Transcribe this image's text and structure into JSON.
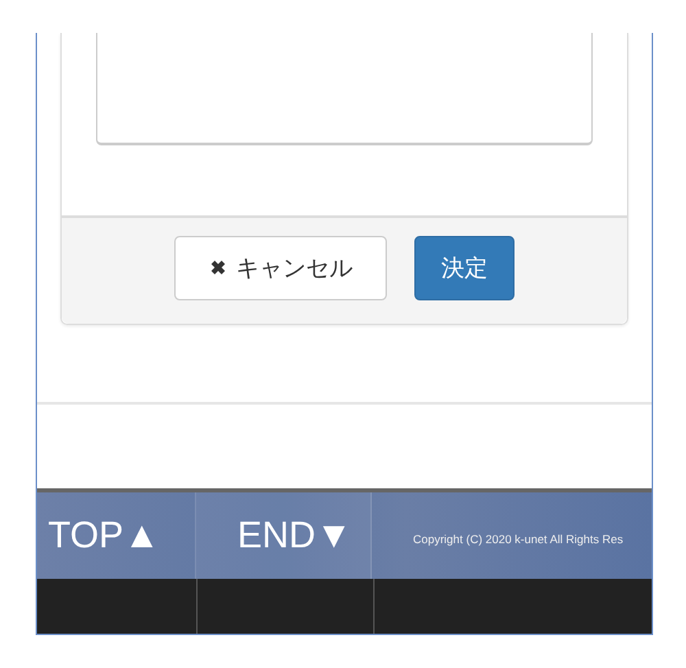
{
  "dialog": {
    "buttons": [
      {
        "kind": "cancel",
        "label": "キャンセル"
      },
      {
        "kind": "primary",
        "label": "決定"
      }
    ]
  },
  "footer": {
    "links": [
      {
        "label": "TOP▲"
      },
      {
        "label": "END▼"
      }
    ],
    "copyright": "Copyright (C) 2020 k-unet All Rights Res"
  }
}
